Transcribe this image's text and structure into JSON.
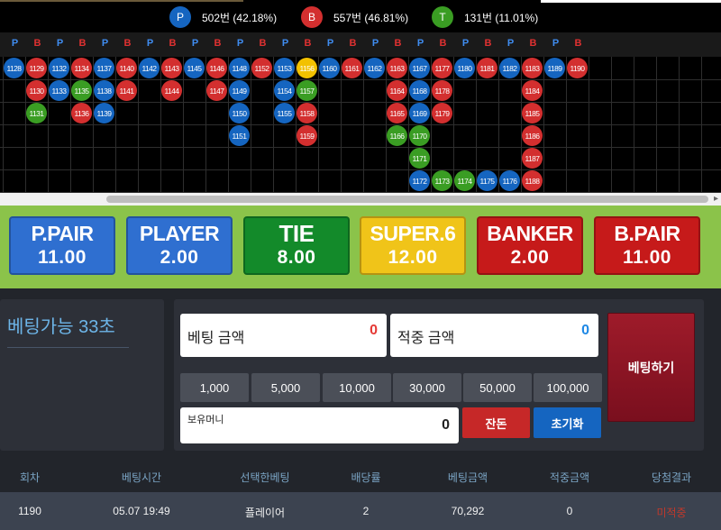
{
  "stats": {
    "player": {
      "icon": "P",
      "text": "502번 (42.18%)",
      "color": "#1565c0"
    },
    "banker": {
      "icon": "B",
      "text": "557번 (46.81%)",
      "color": "#d32f2f"
    },
    "tie": {
      "icon": "T",
      "text": "131번 (11.01%)",
      "color": "#3a9d23"
    }
  },
  "road_map": {
    "header_labels": [
      "P",
      "B",
      "P",
      "B",
      "P",
      "B",
      "P",
      "B",
      "P",
      "B",
      "P",
      "B",
      "P",
      "B",
      "P",
      "B",
      "P",
      "B",
      "P",
      "B",
      "P",
      "B",
      "P",
      "B",
      "P",
      "B"
    ],
    "columns": [
      [
        {
          "n": "1128",
          "r": "p"
        }
      ],
      [
        {
          "n": "1129",
          "r": "b"
        },
        {
          "n": "1130",
          "r": "b"
        },
        {
          "n": "1131",
          "r": "t"
        }
      ],
      [
        {
          "n": "1132",
          "r": "p"
        },
        {
          "n": "1133",
          "r": "p"
        }
      ],
      [
        {
          "n": "1134",
          "r": "b"
        },
        {
          "n": "1135",
          "r": "t"
        },
        {
          "n": "1136",
          "r": "b"
        }
      ],
      [
        {
          "n": "1137",
          "r": "p"
        },
        {
          "n": "1138",
          "r": "p"
        },
        {
          "n": "1139",
          "r": "p"
        }
      ],
      [
        {
          "n": "1140",
          "r": "b"
        },
        {
          "n": "1141",
          "r": "b"
        }
      ],
      [
        {
          "n": "1142",
          "r": "p"
        }
      ],
      [
        {
          "n": "1143",
          "r": "b"
        },
        {
          "n": "1144",
          "r": "b"
        }
      ],
      [
        {
          "n": "1145",
          "r": "p"
        }
      ],
      [
        {
          "n": "1146",
          "r": "b"
        },
        {
          "n": "1147",
          "r": "b"
        }
      ],
      [
        {
          "n": "1148",
          "r": "p"
        },
        {
          "n": "1149",
          "r": "p"
        },
        {
          "n": "1150",
          "r": "p"
        },
        {
          "n": "1151",
          "r": "p"
        }
      ],
      [
        {
          "n": "1152",
          "r": "b"
        }
      ],
      [
        {
          "n": "1153",
          "r": "p"
        },
        {
          "n": "1154",
          "r": "p"
        },
        {
          "n": "1155",
          "r": "p"
        }
      ],
      [
        {
          "n": "1156",
          "r": "y"
        },
        {
          "n": "1157",
          "r": "t"
        },
        {
          "n": "1158",
          "r": "b"
        },
        {
          "n": "1159",
          "r": "b"
        }
      ],
      [
        {
          "n": "1160",
          "r": "p"
        }
      ],
      [
        {
          "n": "1161",
          "r": "b"
        }
      ],
      [
        {
          "n": "1162",
          "r": "p"
        }
      ],
      [
        {
          "n": "1163",
          "r": "b"
        },
        {
          "n": "1164",
          "r": "b"
        },
        {
          "n": "1165",
          "r": "b"
        },
        {
          "n": "1166",
          "r": "t"
        }
      ],
      [
        {
          "n": "1167",
          "r": "p"
        },
        {
          "n": "1168",
          "r": "p"
        },
        {
          "n": "1169",
          "r": "p"
        },
        {
          "n": "1170",
          "r": "t"
        },
        {
          "n": "1171",
          "r": "t"
        },
        {
          "n": "1172",
          "r": "p"
        }
      ],
      [
        {
          "n": "1177",
          "r": "b"
        },
        {
          "n": "1178",
          "r": "b"
        },
        {
          "n": "1179",
          "r": "b"
        },
        null,
        null,
        {
          "n": "1173",
          "r": "t"
        }
      ],
      [
        {
          "n": "1180",
          "r": "p"
        },
        null,
        null,
        null,
        null,
        {
          "n": "1174",
          "r": "t"
        }
      ],
      [
        {
          "n": "1181",
          "r": "b"
        },
        null,
        null,
        null,
        null,
        {
          "n": "1175",
          "r": "p"
        }
      ],
      [
        {
          "n": "1182",
          "r": "p"
        },
        null,
        null,
        null,
        null,
        {
          "n": "1176",
          "r": "p"
        }
      ],
      [
        {
          "n": "1183",
          "r": "b"
        },
        {
          "n": "1184",
          "r": "b"
        },
        {
          "n": "1185",
          "r": "b"
        },
        {
          "n": "1186",
          "r": "b"
        },
        {
          "n": "1187",
          "r": "b"
        },
        {
          "n": "1188",
          "r": "b"
        }
      ],
      [
        {
          "n": "1189",
          "r": "p"
        }
      ],
      [
        {
          "n": "1190",
          "r": "b"
        }
      ]
    ]
  },
  "bet_types": [
    {
      "name": "P.PAIR",
      "odds": "11.00",
      "color": "#2f6fd0"
    },
    {
      "name": "PLAYER",
      "odds": "2.00",
      "color": "#2f6fd0"
    },
    {
      "name": "TIE",
      "odds": "8.00",
      "color": "#138a2a"
    },
    {
      "name": "SUPER.6",
      "odds": "12.00",
      "color": "#f0c419"
    },
    {
      "name": "BANKER",
      "odds": "2.00",
      "color": "#c61a1a"
    },
    {
      "name": "B.PAIR",
      "odds": "11.00",
      "color": "#c61a1a"
    }
  ],
  "betting": {
    "timer_text": "베팅가능 33초",
    "bet_amount_label": "베팅 금액",
    "bet_amount_value": "0",
    "win_amount_label": "적중 금액",
    "win_amount_value": "0",
    "chips": [
      "1,000",
      "5,000",
      "10,000",
      "30,000",
      "50,000",
      "100,000"
    ],
    "balance_label": "보유머니",
    "balance_value": "0",
    "change_button": "잔돈",
    "reset_button": "초기화",
    "place_bet_button": "베팅하기"
  },
  "history": {
    "columns": [
      "회차",
      "베팅시간",
      "선택한베팅",
      "배당률",
      "베팅금액",
      "적중금액",
      "당첨결과"
    ],
    "rows": [
      [
        "1190",
        "05.07 19:49",
        "플레이어",
        "2",
        "70,292",
        "0",
        "미적중"
      ]
    ]
  },
  "colors": {
    "accent_green": "#8bc34a",
    "timer_text": "#6db5e8",
    "miss_result": "#c0392b"
  }
}
